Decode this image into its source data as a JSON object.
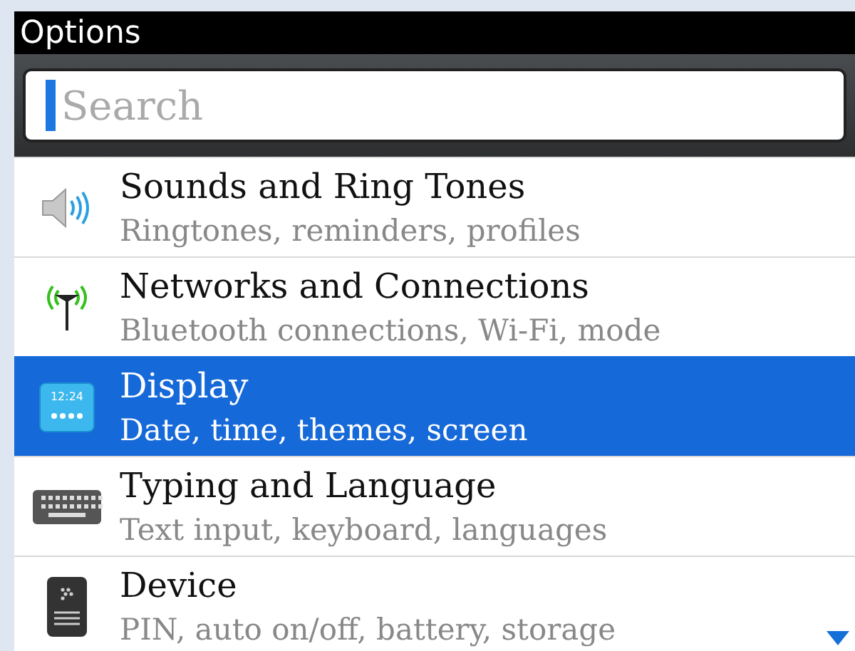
{
  "window": {
    "title": "Options"
  },
  "search": {
    "placeholder": "Search"
  },
  "items": [
    {
      "kind": "speaker",
      "title": "Sounds and Ring Tones",
      "subtitle": "Ringtones, reminders, profiles",
      "selected": false
    },
    {
      "kind": "antenna",
      "title": "Networks and Connections",
      "subtitle": "Bluetooth connections, Wi-Fi, mode",
      "selected": false
    },
    {
      "kind": "display",
      "icon_text": "12:24",
      "title": "Display",
      "subtitle": "Date, time, themes, screen",
      "selected": true
    },
    {
      "kind": "keyboard",
      "title": "Typing and Language",
      "subtitle": "Text input, keyboard, languages",
      "selected": false
    },
    {
      "kind": "device",
      "title": "Device",
      "subtitle": "PIN, auto on/off, battery, storage",
      "selected": false
    }
  ]
}
